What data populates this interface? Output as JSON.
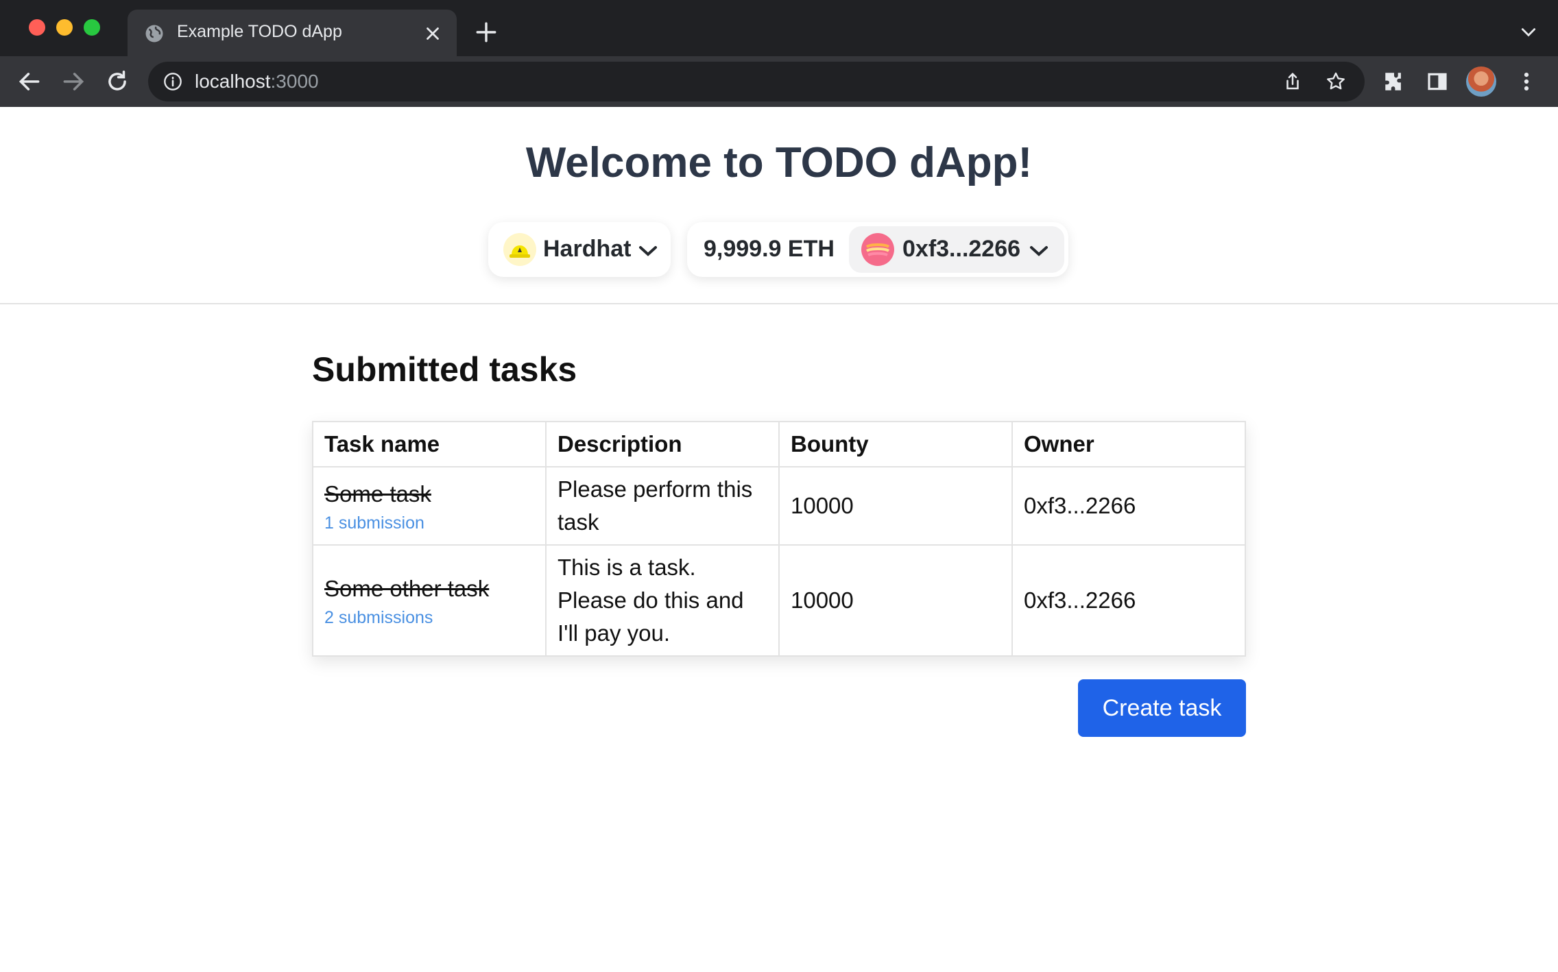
{
  "browser": {
    "tab_title": "Example TODO dApp",
    "url_host": "localhost",
    "url_port": ":3000"
  },
  "header": {
    "title": "Welcome to TODO dApp!",
    "chain_label": "Hardhat",
    "balance": "9,999.9 ETH",
    "account": "0xf3...2266"
  },
  "main": {
    "section_title": "Submitted tasks",
    "columns": [
      "Task name",
      "Description",
      "Bounty",
      "Owner"
    ],
    "rows": [
      {
        "task_name": "Some task",
        "submissions": "1 submission",
        "description": "Please perform this task",
        "bounty": "10000",
        "owner": "0xf3...2266"
      },
      {
        "task_name": "Some other task",
        "submissions": "2 submissions",
        "description": "This is a task. Please do this and I'll pay you.",
        "bounty": "10000",
        "owner": "0xf3...2266"
      }
    ],
    "create_label": "Create task"
  },
  "colors": {
    "primary_button": "#1f63e8",
    "link": "#4a90e2",
    "heading": "#2d3748"
  }
}
